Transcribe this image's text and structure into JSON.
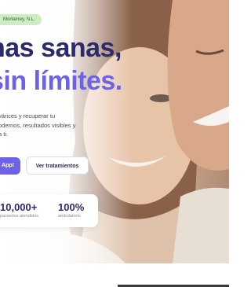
{
  "location_badge": "Monterrey, N.L.",
  "headline": {
    "line1": "nas sanas,",
    "line2": "sin límites."
  },
  "description": {
    "line1": "várices y recuperar tu",
    "line2": "odernos, resultados visibles y",
    "line3": "a ti."
  },
  "buttons": {
    "primary_label": "App!",
    "secondary_label": "Ver tratamientos"
  },
  "stats": [
    {
      "value": "10,000+",
      "label": "pacientes atendidos"
    },
    {
      "value": "100%",
      "label": "ambulatorio"
    }
  ],
  "colors": {
    "headline_dark": "#2b2a6b",
    "headline_accent": "#6e63e4",
    "badge_bg": "#cdeec3"
  }
}
